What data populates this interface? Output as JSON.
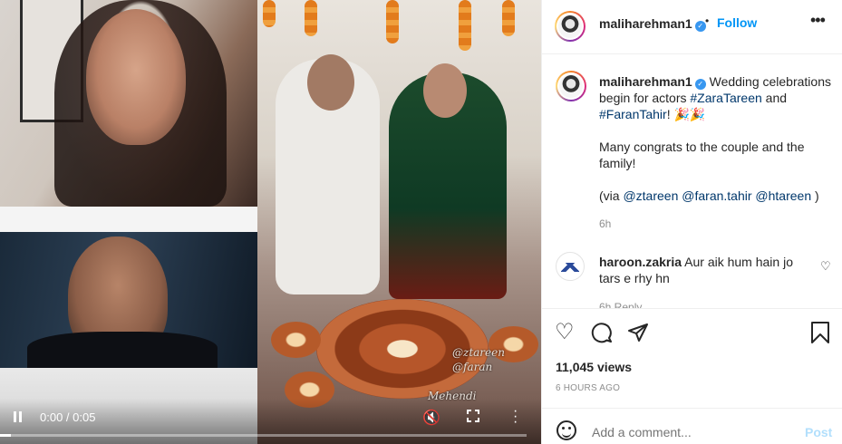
{
  "video": {
    "time": "0:00 / 0:05",
    "progress_fraction": 0.02,
    "watermark_1": "@ztareen",
    "watermark_2": "@faran",
    "watermark_3": "Mehendi"
  },
  "header": {
    "username": "maliharehman1",
    "separator": "•",
    "follow_label": "Follow",
    "more_icon": "more-horizontal-icon"
  },
  "caption": {
    "username": "maliharehman1",
    "text_before": " Wedding celebrations begin for actors ",
    "hashtag_1": "#ZaraTareen",
    "text_and": " and ",
    "hashtag_2": "#FaranTahir",
    "text_emoji": "! 🎉🎉",
    "line_2": "Many congrats to the couple and the family!",
    "via_prefix": "(via ",
    "mention_1": "@ztareen",
    "mention_2": "@faran.tahir",
    "mention_3": "@htareen",
    "via_suffix": " )",
    "time": "6h"
  },
  "comment": {
    "username": "haroon.zakria",
    "text": " Aur aik hum hain jo tars e rhy hn",
    "meta": "6h   Reply"
  },
  "actions": {
    "views": "11,045 views",
    "ago": "6 HOURS AGO"
  },
  "add_comment": {
    "placeholder": "Add a comment...",
    "post_label": "Post"
  },
  "colors": {
    "link": "#00376b",
    "follow": "#0095f6",
    "muted": "#8e8e8e",
    "post_disabled": "#b2dffc"
  }
}
